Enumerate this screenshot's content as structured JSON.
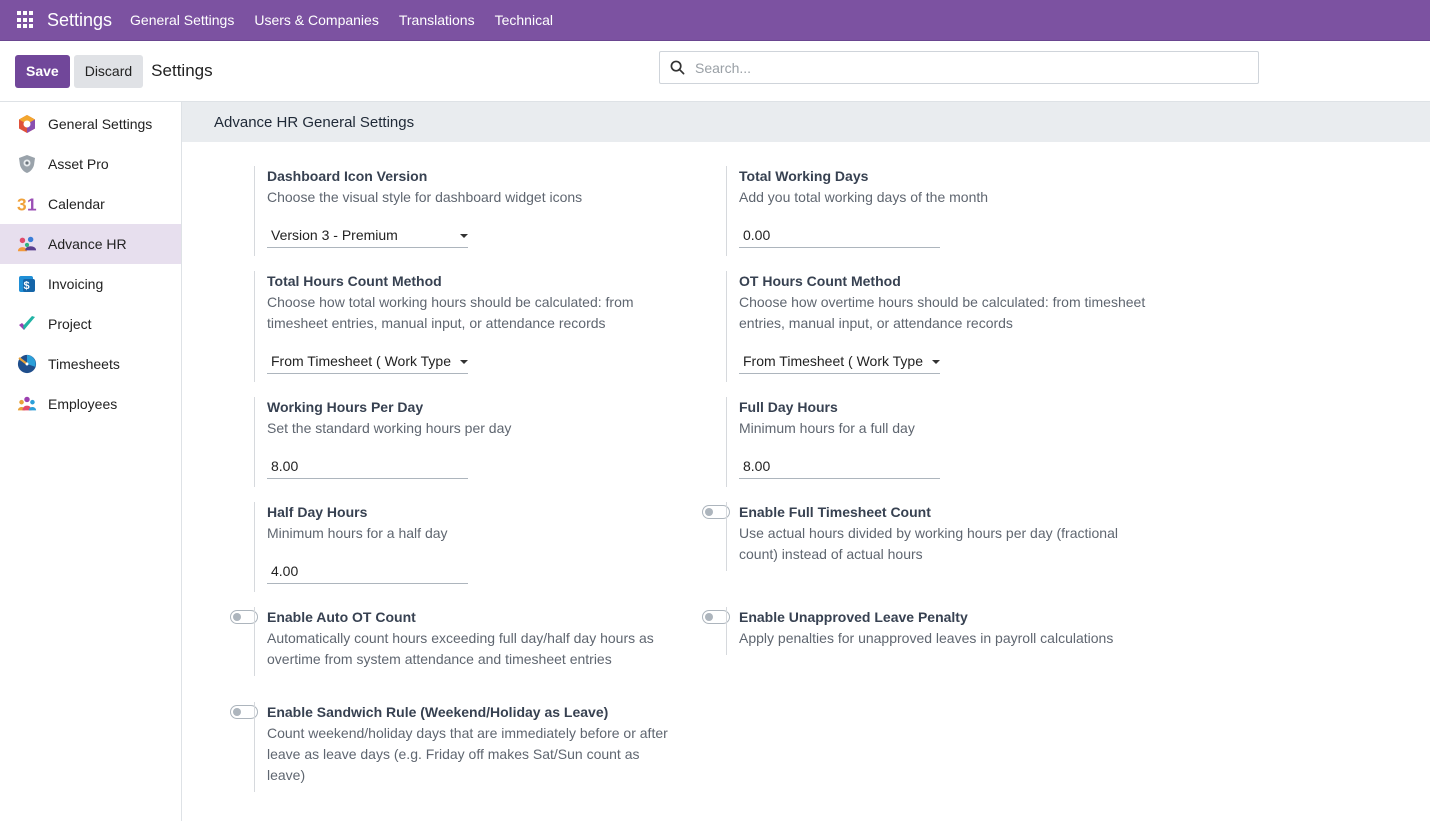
{
  "navbar": {
    "brand": "Settings",
    "items": [
      "General Settings",
      "Users & Companies",
      "Translations",
      "Technical"
    ]
  },
  "control_panel": {
    "save_label": "Save",
    "discard_label": "Discard",
    "title": "Settings",
    "search_placeholder": "Search..."
  },
  "sidebar": {
    "items": [
      {
        "label": "General Settings",
        "icon": "odoo-general-icon"
      },
      {
        "label": "Asset Pro",
        "icon": "asset-shield-icon"
      },
      {
        "label": "Calendar",
        "icon": "calendar-31-icon"
      },
      {
        "label": "Advance HR",
        "icon": "people-hr-icon"
      },
      {
        "label": "Invoicing",
        "icon": "invoice-dollar-icon"
      },
      {
        "label": "Project",
        "icon": "check-icon"
      },
      {
        "label": "Timesheets",
        "icon": "clock-icon"
      },
      {
        "label": "Employees",
        "icon": "employees-icon"
      }
    ]
  },
  "section": {
    "title": "Advance HR General Settings"
  },
  "settings": {
    "dashboard_icon": {
      "title": "Dashboard Icon Version",
      "desc": "Choose the visual style for dashboard widget icons",
      "value": "Version 3 - Premium"
    },
    "total_working_days": {
      "title": "Total Working Days",
      "desc": "Add you total working days of the month",
      "value": "0.00"
    },
    "total_hours_method": {
      "title": "Total Hours Count Method",
      "desc": "Choose how total working hours should be calculated: from timesheet entries, manual input, or attendance records",
      "value": "From Timesheet ( Work Type"
    },
    "ot_hours_method": {
      "title": "OT Hours Count Method",
      "desc": "Choose how overtime hours should be calculated: from timesheet entries, manual input, or attendance records",
      "value": "From Timesheet ( Work Type"
    },
    "working_hours_per_day": {
      "title": "Working Hours Per Day",
      "desc": "Set the standard working hours per day",
      "value": "8.00"
    },
    "full_day_hours": {
      "title": "Full Day Hours",
      "desc": "Minimum hours for a full day",
      "value": "8.00"
    },
    "half_day_hours": {
      "title": "Half Day Hours",
      "desc": "Minimum hours for a half day",
      "value": "4.00"
    },
    "full_timesheet_count": {
      "title": "Enable Full Timesheet Count",
      "desc": "Use actual hours divided by working hours per day (fractional count) instead of actual hours"
    },
    "auto_ot_count": {
      "title": "Enable Auto OT Count",
      "desc": "Automatically count hours exceeding full day/half day hours as overtime from system attendance and timesheet entries"
    },
    "unapproved_leave_penalty": {
      "title": "Enable Unapproved Leave Penalty",
      "desc": "Apply penalties for unapproved leaves in payroll calculations"
    },
    "sandwich_rule": {
      "title": "Enable Sandwich Rule (Weekend/Holiday as Leave)",
      "desc": "Count weekend/holiday days that are immediately before or after leave as leave days (e.g. Friday off makes Sat/Sun count as leave)"
    }
  },
  "colors": {
    "navbar": "#7c52a1",
    "primary_button": "#71479a",
    "active_sidebar": "#e7dfee"
  }
}
